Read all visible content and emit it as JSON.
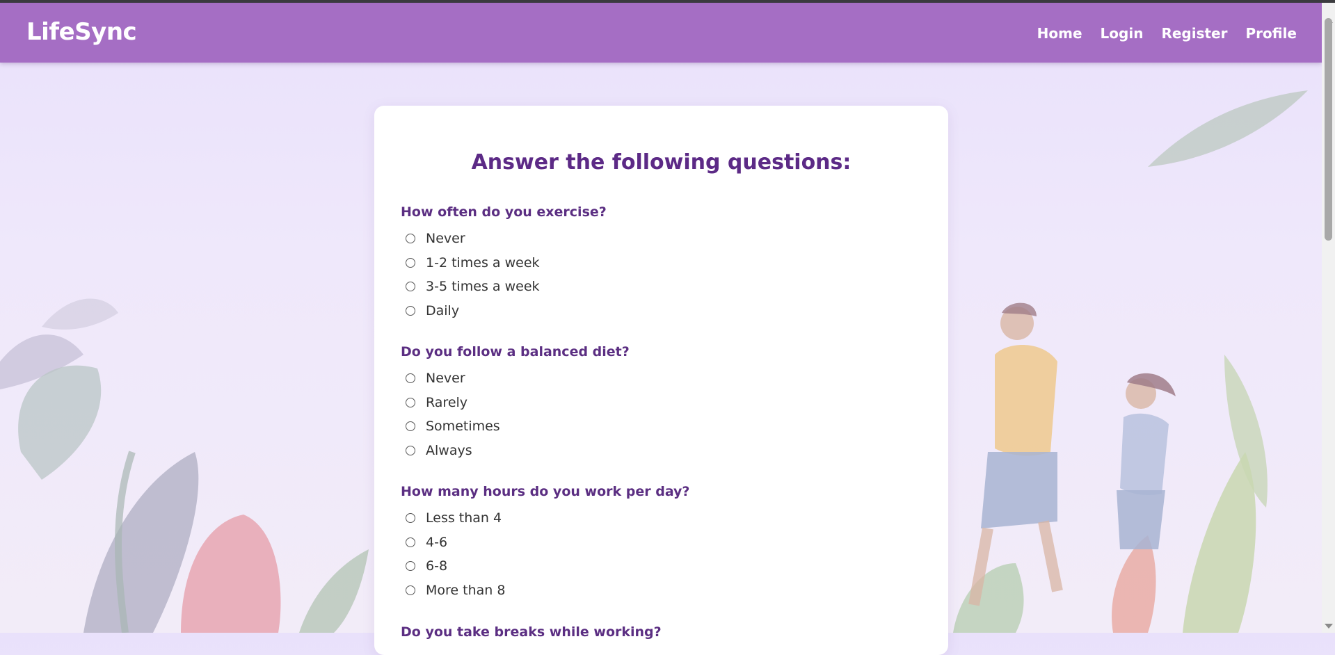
{
  "header": {
    "brand": "LifeSync",
    "nav": [
      "Home",
      "Login",
      "Register",
      "Profile"
    ]
  },
  "form": {
    "heading": "Answer the following questions:",
    "questions": [
      {
        "title": "How often do you exercise?",
        "options": [
          "Never",
          "1-2 times a week",
          "3-5 times a week",
          "Daily"
        ]
      },
      {
        "title": "Do you follow a balanced diet?",
        "options": [
          "Never",
          "Rarely",
          "Sometimes",
          "Always"
        ]
      },
      {
        "title": "How many hours do you work per day?",
        "options": [
          "Less than 4",
          "4-6",
          "6-8",
          "More than 8"
        ]
      },
      {
        "title": "Do you take breaks while working?",
        "options": []
      }
    ]
  },
  "colors": {
    "navbar": "#a56ec4",
    "heading": "#5c2a86",
    "question": "#5b2e82"
  }
}
